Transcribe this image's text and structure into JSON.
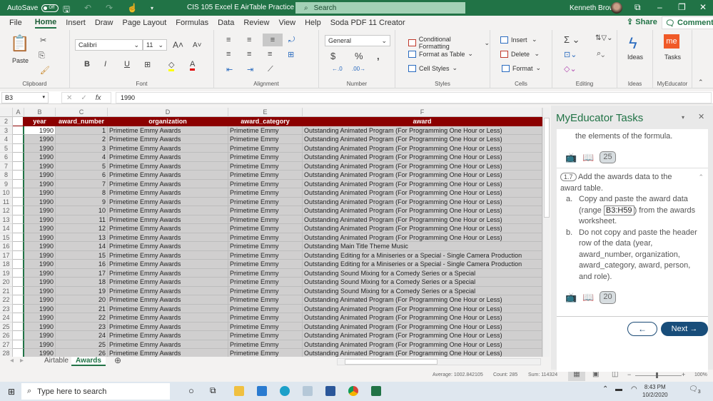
{
  "titlebar": {
    "autosave_label": "AutoSave",
    "autosave_state": "Off",
    "doc_title": "CIS 105 Excel E AirTable Practice",
    "search_label": "Search",
    "user_name": "Kenneth Brown"
  },
  "menu": {
    "items": [
      "File",
      "Home",
      "Insert",
      "Draw",
      "Page Layout",
      "Formulas",
      "Data",
      "Review",
      "View",
      "Help",
      "Soda PDF 11 Creator"
    ],
    "active": "Home",
    "share_label": "Share",
    "comments_label": "Comments"
  },
  "ribbon": {
    "clipboard": {
      "label": "Clipboard",
      "paste": "Paste"
    },
    "font": {
      "label": "Font",
      "name": "Calibri",
      "size": "11"
    },
    "alignment": {
      "label": "Alignment"
    },
    "number": {
      "label": "Number",
      "format": "General"
    },
    "styles": {
      "label": "Styles",
      "conditional": "Conditional Formatting",
      "format_table": "Format as Table",
      "cell_styles": "Cell Styles"
    },
    "cells": {
      "label": "Cells",
      "insert": "Insert",
      "delete": "Delete",
      "format": "Format"
    },
    "editing": {
      "label": "Editing"
    },
    "ideas": {
      "label": "Ideas",
      "button": "Ideas"
    },
    "myeducator": {
      "label": "MyEducator",
      "button": "Tasks",
      "logo": "me"
    }
  },
  "formula_bar": {
    "name_box": "B3",
    "value": "1990"
  },
  "sheet": {
    "columns": [
      "A",
      "B",
      "C",
      "D",
      "E",
      "F"
    ],
    "headers": [
      "year",
      "award_number",
      "organization",
      "award_category",
      "award"
    ],
    "rows": [
      {
        "n": "3",
        "year": "1990",
        "num": "1",
        "org": "Primetime Emmy Awards",
        "cat": "Primetime Emmy",
        "award": "Outstanding Animated Program (For Programming One Hour or Less)"
      },
      {
        "n": "4",
        "year": "1990",
        "num": "2",
        "org": "Primetime Emmy Awards",
        "cat": "Primetime Emmy",
        "award": "Outstanding Animated Program (For Programming One Hour or Less)"
      },
      {
        "n": "5",
        "year": "1990",
        "num": "3",
        "org": "Primetime Emmy Awards",
        "cat": "Primetime Emmy",
        "award": "Outstanding Animated Program (For Programming One Hour or Less)"
      },
      {
        "n": "6",
        "year": "1990",
        "num": "4",
        "org": "Primetime Emmy Awards",
        "cat": "Primetime Emmy",
        "award": "Outstanding Animated Program (For Programming One Hour or Less)"
      },
      {
        "n": "7",
        "year": "1990",
        "num": "5",
        "org": "Primetime Emmy Awards",
        "cat": "Primetime Emmy",
        "award": "Outstanding Animated Program (For Programming One Hour or Less)"
      },
      {
        "n": "8",
        "year": "1990",
        "num": "6",
        "org": "Primetime Emmy Awards",
        "cat": "Primetime Emmy",
        "award": "Outstanding Animated Program (For Programming One Hour or Less)"
      },
      {
        "n": "9",
        "year": "1990",
        "num": "7",
        "org": "Primetime Emmy Awards",
        "cat": "Primetime Emmy",
        "award": "Outstanding Animated Program (For Programming One Hour or Less)"
      },
      {
        "n": "10",
        "year": "1990",
        "num": "8",
        "org": "Primetime Emmy Awards",
        "cat": "Primetime Emmy",
        "award": "Outstanding Animated Program (For Programming One Hour or Less)"
      },
      {
        "n": "11",
        "year": "1990",
        "num": "9",
        "org": "Primetime Emmy Awards",
        "cat": "Primetime Emmy",
        "award": "Outstanding Animated Program (For Programming One Hour or Less)"
      },
      {
        "n": "12",
        "year": "1990",
        "num": "10",
        "org": "Primetime Emmy Awards",
        "cat": "Primetime Emmy",
        "award": "Outstanding Animated Program (For Programming One Hour or Less)"
      },
      {
        "n": "13",
        "year": "1990",
        "num": "11",
        "org": "Primetime Emmy Awards",
        "cat": "Primetime Emmy",
        "award": "Outstanding Animated Program (For Programming One Hour or Less)"
      },
      {
        "n": "14",
        "year": "1990",
        "num": "12",
        "org": "Primetime Emmy Awards",
        "cat": "Primetime Emmy",
        "award": "Outstanding Animated Program (For Programming One Hour or Less)"
      },
      {
        "n": "15",
        "year": "1990",
        "num": "13",
        "org": "Primetime Emmy Awards",
        "cat": "Primetime Emmy",
        "award": "Outstanding Animated Program (For Programming One Hour or Less)"
      },
      {
        "n": "16",
        "year": "1990",
        "num": "14",
        "org": "Primetime Emmy Awards",
        "cat": "Primetime Emmy",
        "award": "Outstanding Main Title Theme Music"
      },
      {
        "n": "17",
        "year": "1990",
        "num": "15",
        "org": "Primetime Emmy Awards",
        "cat": "Primetime Emmy",
        "award": "Outstanding Editing for a Miniseries or a Special - Single Camera Production"
      },
      {
        "n": "18",
        "year": "1990",
        "num": "16",
        "org": "Primetime Emmy Awards",
        "cat": "Primetime Emmy",
        "award": "Outstanding Editing for a Miniseries or a Special - Single Camera Production"
      },
      {
        "n": "19",
        "year": "1990",
        "num": "17",
        "org": "Primetime Emmy Awards",
        "cat": "Primetime Emmy",
        "award": "Outstanding Sound Mixing for a Comedy Series or a Special"
      },
      {
        "n": "20",
        "year": "1990",
        "num": "18",
        "org": "Primetime Emmy Awards",
        "cat": "Primetime Emmy",
        "award": "Outstanding Sound Mixing for a Comedy Series or a Special"
      },
      {
        "n": "21",
        "year": "1990",
        "num": "19",
        "org": "Primetime Emmy Awards",
        "cat": "Primetime Emmy",
        "award": "Outstanding Sound Mixing for a Comedy Series or a Special"
      },
      {
        "n": "22",
        "year": "1990",
        "num": "20",
        "org": "Primetime Emmy Awards",
        "cat": "Primetime Emmy",
        "award": "Outstanding Animated Program (For Programming One Hour or Less)"
      },
      {
        "n": "23",
        "year": "1990",
        "num": "21",
        "org": "Primetime Emmy Awards",
        "cat": "Primetime Emmy",
        "award": "Outstanding Animated Program (For Programming One Hour or Less)"
      },
      {
        "n": "24",
        "year": "1990",
        "num": "22",
        "org": "Primetime Emmy Awards",
        "cat": "Primetime Emmy",
        "award": "Outstanding Animated Program (For Programming One Hour or Less)"
      },
      {
        "n": "25",
        "year": "1990",
        "num": "23",
        "org": "Primetime Emmy Awards",
        "cat": "Primetime Emmy",
        "award": "Outstanding Animated Program (For Programming One Hour or Less)"
      },
      {
        "n": "26",
        "year": "1990",
        "num": "24",
        "org": "Primetime Emmy Awards",
        "cat": "Primetime Emmy",
        "award": "Outstanding Animated Program (For Programming One Hour or Less)"
      },
      {
        "n": "27",
        "year": "1990",
        "num": "25",
        "org": "Primetime Emmy Awards",
        "cat": "Primetime Emmy",
        "award": "Outstanding Animated Program (For Programming One Hour or Less)"
      },
      {
        "n": "28",
        "year": "1990",
        "num": "26",
        "org": "Primetime Emmy Awards",
        "cat": "Primetime Emmy",
        "award": "Outstanding Animated Program (For Programming One Hour or Less)"
      }
    ],
    "header_color": "#8b0000"
  },
  "sheet_tabs": [
    "Airtable",
    "Awards"
  ],
  "active_tab": "Awards",
  "status": {
    "average": "Average: 1002.842105",
    "count": "Count: 285",
    "sum": "Sum: 114324",
    "zoom": "100%"
  },
  "task_pane": {
    "title": "MyEducator Tasks",
    "prev_text": "the elements of the formula.",
    "prev_badge": "25",
    "step_num": "1.7",
    "step_title": "Add the awards data to the award table.",
    "a_prefix": "a.",
    "a_text_1": "Copy and paste the award data (range",
    "a_range": "B3:H59",
    "a_text_2": ") from the awards worksheet.",
    "b_prefix": "b.",
    "b_text": "Do not copy and paste the header row of the data (year, award_number, organization, award_category, award, person, and role).",
    "step_badge": "20",
    "back_label": "←",
    "next_label": "Next →"
  },
  "taskbar": {
    "search_placeholder": "Type here to search",
    "time": "8:43 PM",
    "date": "10/2/2020",
    "notifications": "3"
  }
}
